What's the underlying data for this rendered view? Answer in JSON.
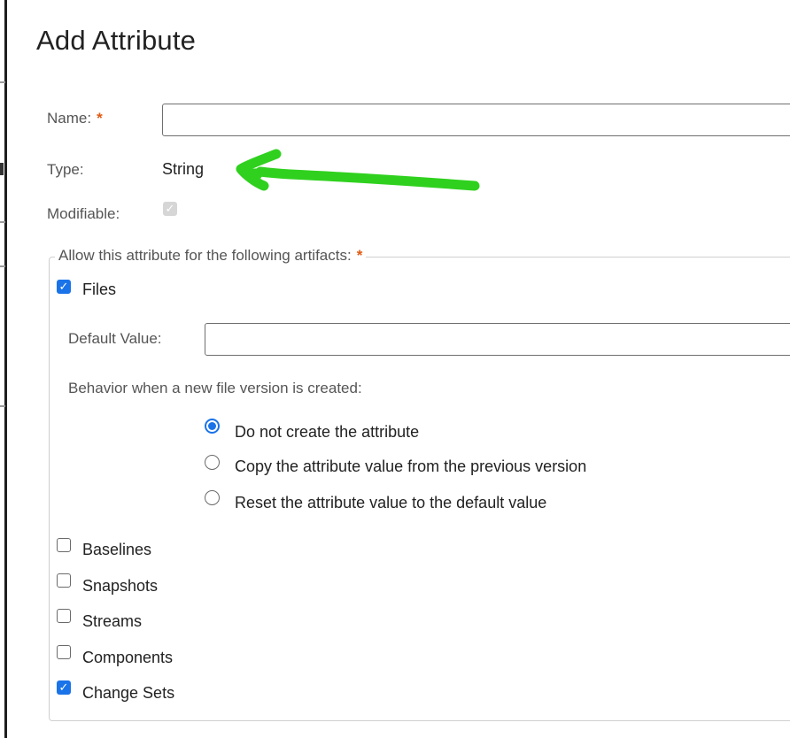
{
  "dialog": {
    "title": "Add Attribute",
    "required_mark": "*"
  },
  "name": {
    "label": "Name:",
    "value": ""
  },
  "type": {
    "label": "Type:",
    "value": "String"
  },
  "modifiable": {
    "label": "Modifiable:",
    "checked": true,
    "disabled": true
  },
  "artifacts": {
    "legend": "Allow this attribute for the following artifacts:",
    "files": {
      "label": "Files",
      "checked": true
    },
    "default_value": {
      "label": "Default Value:",
      "value": ""
    },
    "behavior_label": "Behavior when a new file version is created:",
    "behavior_options": [
      {
        "label": "Do not create the attribute",
        "selected": true
      },
      {
        "label": "Copy the attribute value from the previous version",
        "selected": false
      },
      {
        "label": "Reset the attribute value to the default value",
        "selected": false
      }
    ],
    "others": [
      {
        "label": "Baselines",
        "checked": false
      },
      {
        "label": "Snapshots",
        "checked": false
      },
      {
        "label": "Streams",
        "checked": false
      },
      {
        "label": "Components",
        "checked": false
      },
      {
        "label": "Change Sets",
        "checked": true
      }
    ]
  },
  "colors": {
    "accent": "#1a73e8",
    "required": "#e05a12",
    "annotation_arrow": "#2fd11e"
  },
  "annotation": {
    "icon": "green-arrow-annotation-icon"
  }
}
